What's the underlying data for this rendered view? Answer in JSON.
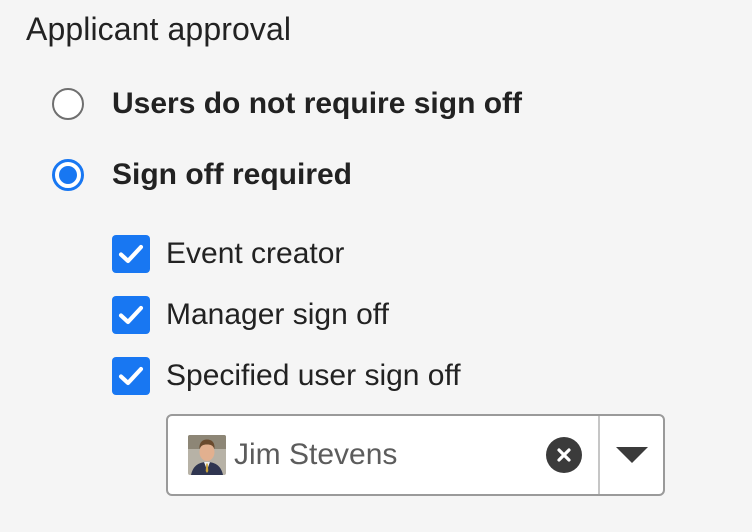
{
  "section": {
    "title": "Applicant approval"
  },
  "approval_options": [
    {
      "label": "Users do not require sign off",
      "selected": false
    },
    {
      "label": "Sign off required",
      "selected": true
    }
  ],
  "sign_off_checks": [
    {
      "label": "Event creator",
      "checked": true
    },
    {
      "label": "Manager sign off",
      "checked": true
    },
    {
      "label": "Specified user sign off",
      "checked": true
    }
  ],
  "user_select": {
    "value": "Jim Stevens",
    "avatar_icon": "user-avatar",
    "clear_icon": "clear-circle-x-icon",
    "dropdown_icon": "caret-down-icon"
  },
  "colors": {
    "accent": "#1877f2",
    "background": "#f5f5f5"
  }
}
